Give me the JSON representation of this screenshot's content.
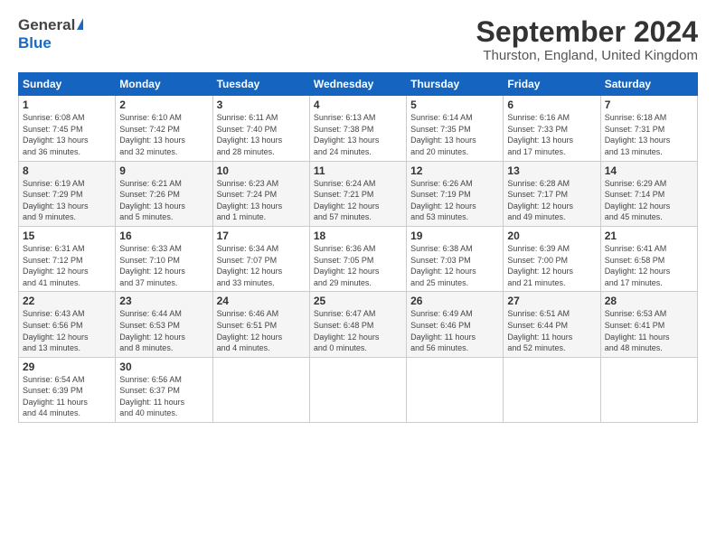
{
  "header": {
    "logo_general": "General",
    "logo_blue": "Blue",
    "main_title": "September 2024",
    "subtitle": "Thurston, England, United Kingdom"
  },
  "calendar": {
    "days_of_week": [
      "Sunday",
      "Monday",
      "Tuesday",
      "Wednesday",
      "Thursday",
      "Friday",
      "Saturday"
    ],
    "weeks": [
      [
        {
          "day": "1",
          "info": "Sunrise: 6:08 AM\nSunset: 7:45 PM\nDaylight: 13 hours\nand 36 minutes."
        },
        {
          "day": "2",
          "info": "Sunrise: 6:10 AM\nSunset: 7:42 PM\nDaylight: 13 hours\nand 32 minutes."
        },
        {
          "day": "3",
          "info": "Sunrise: 6:11 AM\nSunset: 7:40 PM\nDaylight: 13 hours\nand 28 minutes."
        },
        {
          "day": "4",
          "info": "Sunrise: 6:13 AM\nSunset: 7:38 PM\nDaylight: 13 hours\nand 24 minutes."
        },
        {
          "day": "5",
          "info": "Sunrise: 6:14 AM\nSunset: 7:35 PM\nDaylight: 13 hours\nand 20 minutes."
        },
        {
          "day": "6",
          "info": "Sunrise: 6:16 AM\nSunset: 7:33 PM\nDaylight: 13 hours\nand 17 minutes."
        },
        {
          "day": "7",
          "info": "Sunrise: 6:18 AM\nSunset: 7:31 PM\nDaylight: 13 hours\nand 13 minutes."
        }
      ],
      [
        {
          "day": "8",
          "info": "Sunrise: 6:19 AM\nSunset: 7:29 PM\nDaylight: 13 hours\nand 9 minutes."
        },
        {
          "day": "9",
          "info": "Sunrise: 6:21 AM\nSunset: 7:26 PM\nDaylight: 13 hours\nand 5 minutes."
        },
        {
          "day": "10",
          "info": "Sunrise: 6:23 AM\nSunset: 7:24 PM\nDaylight: 13 hours\nand 1 minute."
        },
        {
          "day": "11",
          "info": "Sunrise: 6:24 AM\nSunset: 7:21 PM\nDaylight: 12 hours\nand 57 minutes."
        },
        {
          "day": "12",
          "info": "Sunrise: 6:26 AM\nSunset: 7:19 PM\nDaylight: 12 hours\nand 53 minutes."
        },
        {
          "day": "13",
          "info": "Sunrise: 6:28 AM\nSunset: 7:17 PM\nDaylight: 12 hours\nand 49 minutes."
        },
        {
          "day": "14",
          "info": "Sunrise: 6:29 AM\nSunset: 7:14 PM\nDaylight: 12 hours\nand 45 minutes."
        }
      ],
      [
        {
          "day": "15",
          "info": "Sunrise: 6:31 AM\nSunset: 7:12 PM\nDaylight: 12 hours\nand 41 minutes."
        },
        {
          "day": "16",
          "info": "Sunrise: 6:33 AM\nSunset: 7:10 PM\nDaylight: 12 hours\nand 37 minutes."
        },
        {
          "day": "17",
          "info": "Sunrise: 6:34 AM\nSunset: 7:07 PM\nDaylight: 12 hours\nand 33 minutes."
        },
        {
          "day": "18",
          "info": "Sunrise: 6:36 AM\nSunset: 7:05 PM\nDaylight: 12 hours\nand 29 minutes."
        },
        {
          "day": "19",
          "info": "Sunrise: 6:38 AM\nSunset: 7:03 PM\nDaylight: 12 hours\nand 25 minutes."
        },
        {
          "day": "20",
          "info": "Sunrise: 6:39 AM\nSunset: 7:00 PM\nDaylight: 12 hours\nand 21 minutes."
        },
        {
          "day": "21",
          "info": "Sunrise: 6:41 AM\nSunset: 6:58 PM\nDaylight: 12 hours\nand 17 minutes."
        }
      ],
      [
        {
          "day": "22",
          "info": "Sunrise: 6:43 AM\nSunset: 6:56 PM\nDaylight: 12 hours\nand 13 minutes."
        },
        {
          "day": "23",
          "info": "Sunrise: 6:44 AM\nSunset: 6:53 PM\nDaylight: 12 hours\nand 8 minutes."
        },
        {
          "day": "24",
          "info": "Sunrise: 6:46 AM\nSunset: 6:51 PM\nDaylight: 12 hours\nand 4 minutes."
        },
        {
          "day": "25",
          "info": "Sunrise: 6:47 AM\nSunset: 6:48 PM\nDaylight: 12 hours\nand 0 minutes."
        },
        {
          "day": "26",
          "info": "Sunrise: 6:49 AM\nSunset: 6:46 PM\nDaylight: 11 hours\nand 56 minutes."
        },
        {
          "day": "27",
          "info": "Sunrise: 6:51 AM\nSunset: 6:44 PM\nDaylight: 11 hours\nand 52 minutes."
        },
        {
          "day": "28",
          "info": "Sunrise: 6:53 AM\nSunset: 6:41 PM\nDaylight: 11 hours\nand 48 minutes."
        }
      ],
      [
        {
          "day": "29",
          "info": "Sunrise: 6:54 AM\nSunset: 6:39 PM\nDaylight: 11 hours\nand 44 minutes."
        },
        {
          "day": "30",
          "info": "Sunrise: 6:56 AM\nSunset: 6:37 PM\nDaylight: 11 hours\nand 40 minutes."
        },
        {
          "day": "",
          "info": ""
        },
        {
          "day": "",
          "info": ""
        },
        {
          "day": "",
          "info": ""
        },
        {
          "day": "",
          "info": ""
        },
        {
          "day": "",
          "info": ""
        }
      ]
    ]
  }
}
